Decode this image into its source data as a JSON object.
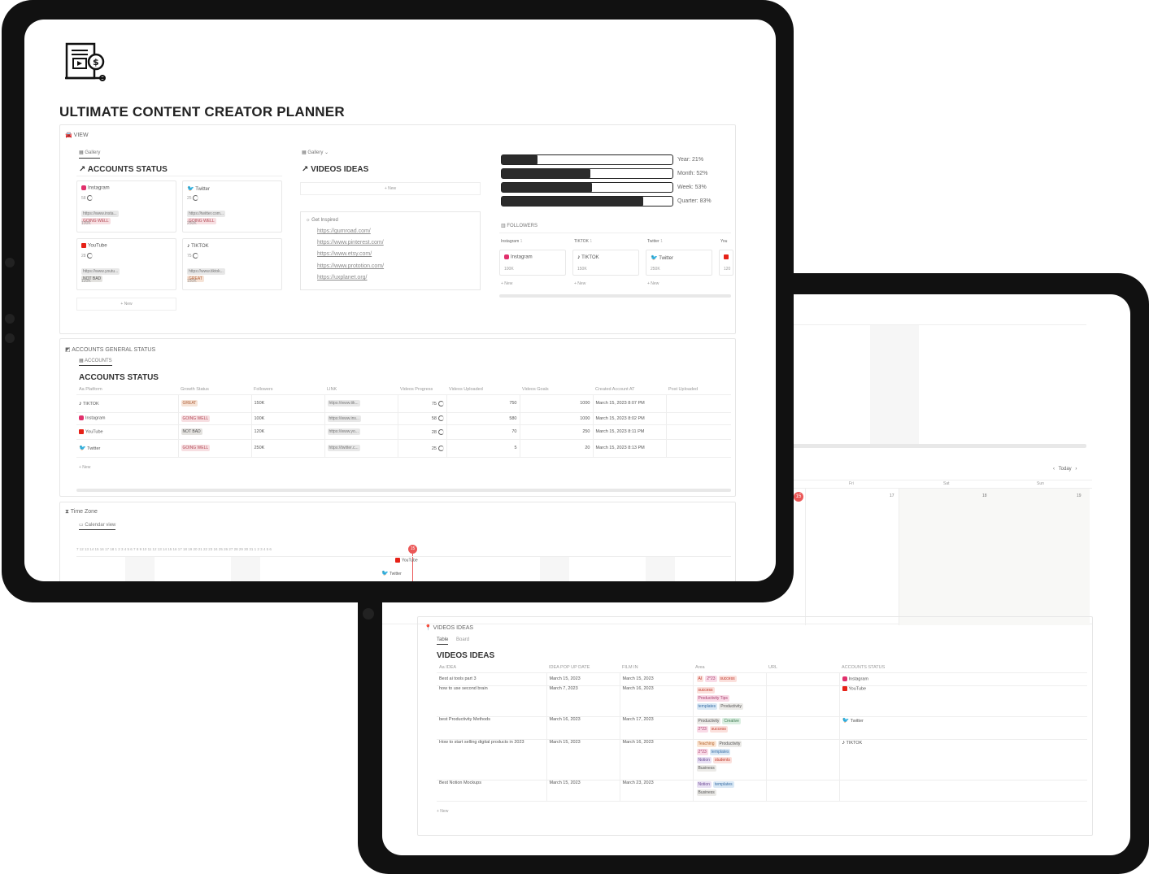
{
  "title": "ULTIMATE CONTENT CREATOR PLANNER",
  "view_section": {
    "label": "VIEW",
    "gallery_tab": "Gallery",
    "accounts_status_title": "ACCOUNTS STATUS",
    "videos_ideas_title": "VIDEOS IDEAS",
    "new_label": "+ New"
  },
  "account_cards": [
    {
      "name": "Instagram",
      "progress": "58",
      "url": "https://www.insta...",
      "status": "GOING WELL",
      "followers": "100K"
    },
    {
      "name": "Twitter",
      "progress": "25",
      "url": "https://twitter.com...",
      "status": "GOING WELL",
      "followers": "250K"
    },
    {
      "name": "YouTube",
      "progress": "28",
      "url": "https://www.youtu...",
      "status": "NOT BAD",
      "followers": "120K"
    },
    {
      "name": "TIKTOK",
      "progress": "75",
      "url": "https://www.tiktok...",
      "status": "GREAT",
      "followers": "150K"
    }
  ],
  "get_inspired": {
    "label": "Get Inspired",
    "links": [
      "https://gumroad.com/",
      "https://www.pinterest.com/",
      "https://www.etsy.com/",
      "https://www.prototion.com/",
      "https://uxplanet.org/"
    ]
  },
  "progress_bars": [
    {
      "label": "Year: 21%",
      "value": 0.21
    },
    {
      "label": "Month: 52%",
      "value": 0.52
    },
    {
      "label": "Week: 53%",
      "value": 0.53
    },
    {
      "label": "Quarter: 83%",
      "value": 0.83
    }
  ],
  "followers": {
    "label": "FOLLOWERS",
    "groups": [
      {
        "name": "Instagram",
        "count": "1",
        "card": "Instagram",
        "value": "100K"
      },
      {
        "name": "TIKTOK",
        "count": "1",
        "card": "TIKTOK",
        "value": "150K"
      },
      {
        "name": "Twitter",
        "count": "1",
        "card": "Twitter",
        "value": "250K"
      },
      {
        "name": "You",
        "count": "",
        "card": "",
        "value": "120"
      }
    ],
    "new_label": "+ New"
  },
  "general_status": {
    "label": "ACCOUNTS GENERAL STATUS",
    "tab": "ACCOUNTS",
    "title": "ACCOUNTS STATUS",
    "columns": [
      "Aa Platform",
      "Growth Status",
      "Followers",
      "LINK",
      "Videos Progress",
      "Videos Uploaded",
      "Videos Goals",
      "Created Account AT",
      "Post Uploaded"
    ],
    "rows": [
      {
        "platform": "TIKTOK",
        "status": "GREAT",
        "followers": "150K",
        "link": "https://www.tik...",
        "progress": "75",
        "uploaded": "750",
        "goals": "1000",
        "created": "March 15, 2023 8:07 PM"
      },
      {
        "platform": "Instagram",
        "status": "GOING WELL",
        "followers": "100K",
        "link": "https://www.ins...",
        "progress": "58",
        "uploaded": "580",
        "goals": "1000",
        "created": "March 15, 2023 8:02 PM"
      },
      {
        "platform": "YouTube",
        "status": "NOT BAD",
        "followers": "120K",
        "link": "https://www.yo...",
        "progress": "28",
        "uploaded": "70",
        "goals": "250",
        "created": "March 15, 2023 8:11 PM"
      },
      {
        "platform": "Twitter",
        "status": "GOING WELL",
        "followers": "250K",
        "link": "https://twitter.c...",
        "progress": "25",
        "uploaded": "5",
        "goals": "20",
        "created": "March 15, 2023 8:13 PM"
      }
    ],
    "new_label": "+ New"
  },
  "time_zone": {
    "label": "Time Zone",
    "tab": "Calendar view",
    "dates": "7  12  13  14  15  16  17  18  1  2  3  4  5  6  7  8  9  10  11  12  13  14  15  16  17  18  19  20  21  22  23  24  25  26  27  28  29  30  31  1  2  3  4  5  6",
    "today": "15",
    "events": [
      "YouTube",
      "Twitter"
    ]
  },
  "calendar_back": {
    "dates_top": "18  19  20  21  22  23  24  25  26  27  28  29  30  31  1  2  3  4  5  6",
    "today_label": "Today",
    "day_numbers": [
      "15",
      "17",
      "18",
      "19"
    ],
    "weekdays": [
      "Fri",
      "Sat",
      "Sun"
    ]
  },
  "videos_ideas": {
    "label": "VIDEOS IDEAS",
    "tabs": [
      "Table",
      "Board"
    ],
    "title": "VIDEOS IDEAS",
    "columns": [
      "Aa IDEA",
      "IDEA POP UP DATE",
      "FILM IN",
      "Area",
      "URL",
      "ACCOUNTS STATUS"
    ],
    "rows": [
      {
        "idea": "Best ai tools part 3",
        "popup": "March 15, 2023",
        "film": "March 15, 2023",
        "tags": [
          [
            "AI",
            "red"
          ],
          [
            "2*23",
            "pink"
          ],
          [
            "success",
            "red"
          ]
        ],
        "account": "Instagram"
      },
      {
        "idea": "how to use second brain",
        "popup": "March 7, 2023",
        "film": "March 16, 2023",
        "tags": [
          [
            "success",
            "red"
          ],
          [
            "Productivity Tips",
            "pink"
          ],
          [
            "templates",
            "blue"
          ],
          [
            "Productivity",
            "gray"
          ]
        ],
        "account": "YouTube"
      },
      {
        "idea": "best Productivity Methods",
        "popup": "March 16, 2023",
        "film": "March 17, 2023",
        "tags": [
          [
            "Productivity",
            "gray"
          ],
          [
            "Creative",
            "green"
          ],
          [
            "2*23",
            "pink"
          ],
          [
            "success",
            "red"
          ]
        ],
        "account": "Twitter"
      },
      {
        "idea": "How to start selling digital products in 2023",
        "popup": "March 15, 2023",
        "film": "March 16, 2023",
        "tags": [
          [
            "Teaching",
            "orange"
          ],
          [
            "Productivity",
            "gray"
          ],
          [
            "2*23",
            "pink"
          ],
          [
            "templates",
            "blue"
          ],
          [
            "Notion",
            "purple"
          ],
          [
            "students",
            "red"
          ],
          [
            "Business",
            "gray"
          ]
        ],
        "account": "TIKTOK"
      },
      {
        "idea": "Best Notion Mockups",
        "popup": "March 15, 2023",
        "film": "March 23, 2023",
        "tags": [
          [
            "Notion",
            "purple"
          ],
          [
            "templates",
            "blue"
          ],
          [
            "Business",
            "gray"
          ]
        ],
        "account": ""
      }
    ],
    "new_label": "+ New"
  }
}
